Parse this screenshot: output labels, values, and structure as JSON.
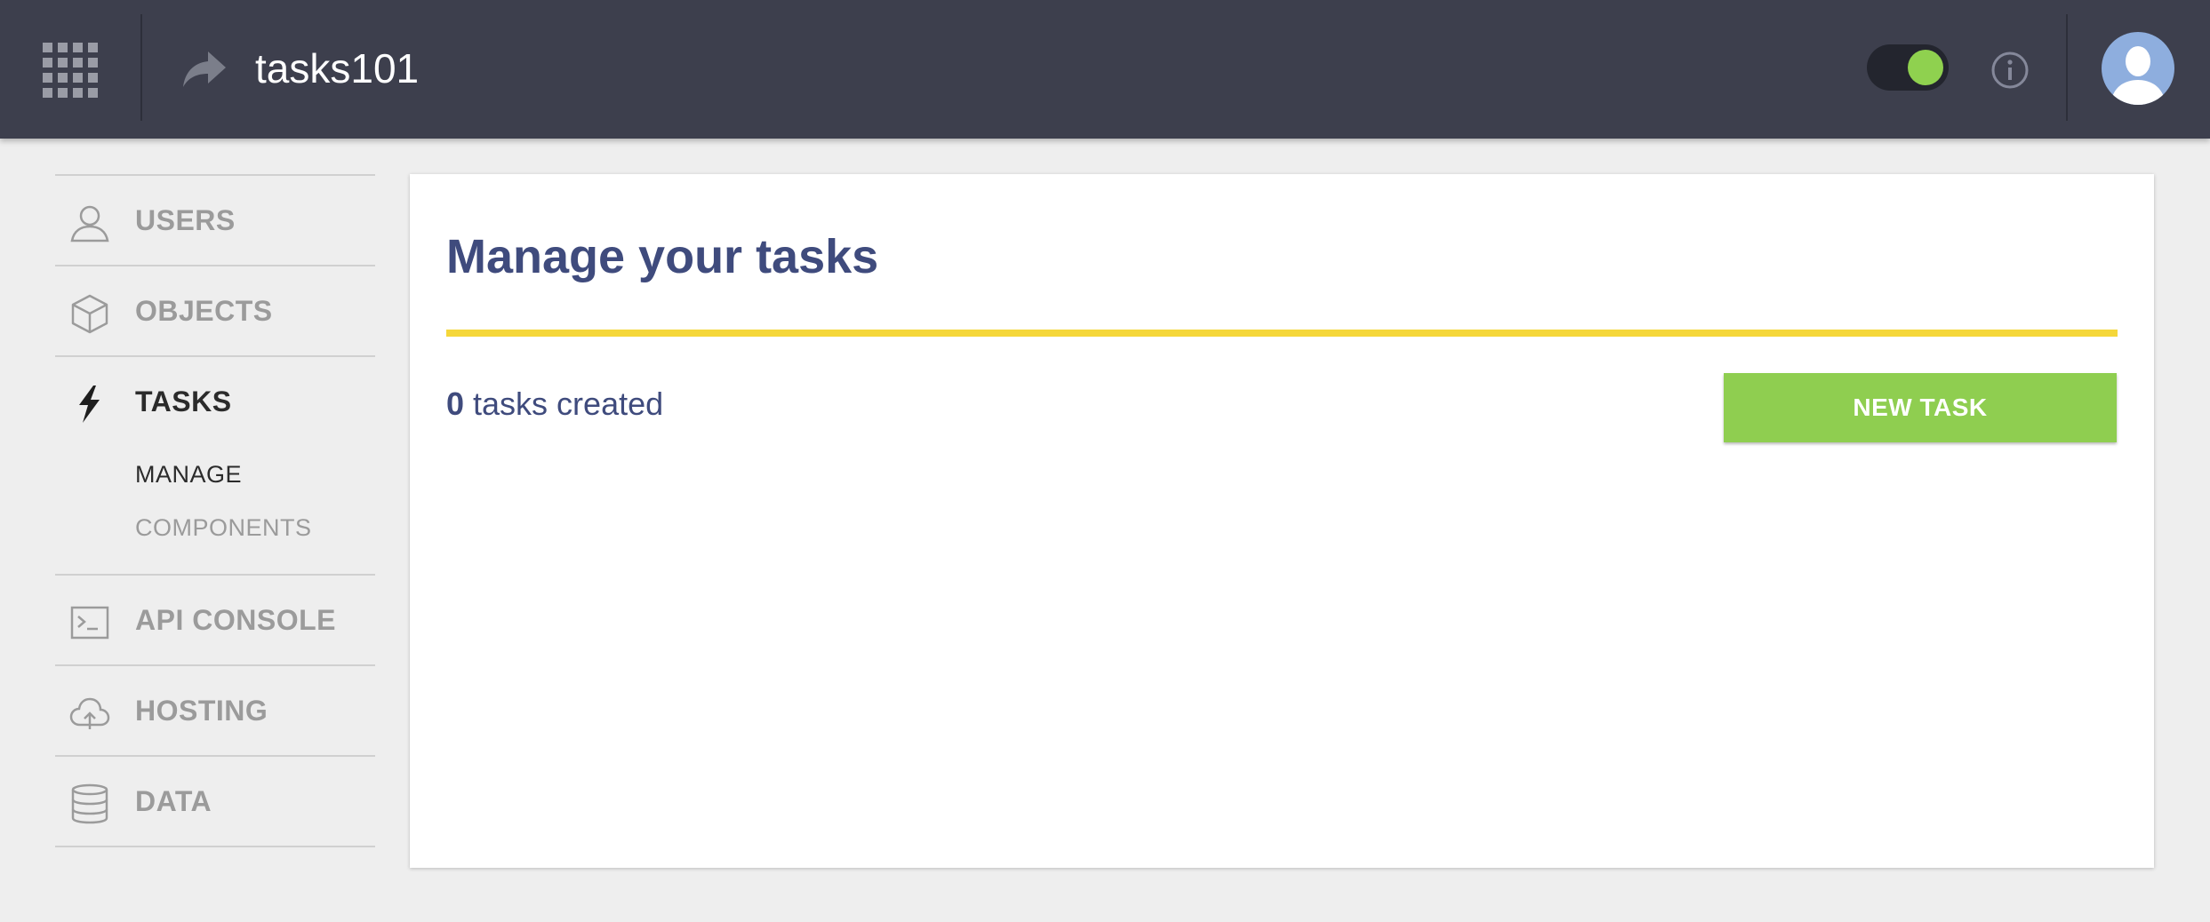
{
  "header": {
    "app_title": "tasks101",
    "apps_icon": "apps-grid-icon",
    "share_icon": "share-arrow-icon",
    "toggle_state": "on",
    "info_icon": "info-icon",
    "avatar_icon": "user-avatar"
  },
  "sidebar": {
    "items": [
      {
        "label": "USERS",
        "icon": "user-icon"
      },
      {
        "label": "OBJECTS",
        "icon": "cube-icon"
      },
      {
        "label": "TASKS",
        "icon": "lightning-bolt-icon",
        "active": true,
        "subitems": [
          {
            "label": "MANAGE",
            "active": true
          },
          {
            "label": "COMPONENTS"
          }
        ]
      },
      {
        "label": "API CONSOLE",
        "icon": "terminal-icon"
      },
      {
        "label": "HOSTING",
        "icon": "cloud-upload-icon"
      },
      {
        "label": "DATA",
        "icon": "database-icon"
      }
    ]
  },
  "main": {
    "title": "Manage your tasks",
    "task_count": "0",
    "task_count_suffix": " tasks created",
    "new_task_label": "NEW TASK"
  },
  "colors": {
    "topbar": "#3d3f4d",
    "title": "#3f4b7d",
    "rule": "#f5d73a",
    "accent_green": "#8fce50"
  }
}
